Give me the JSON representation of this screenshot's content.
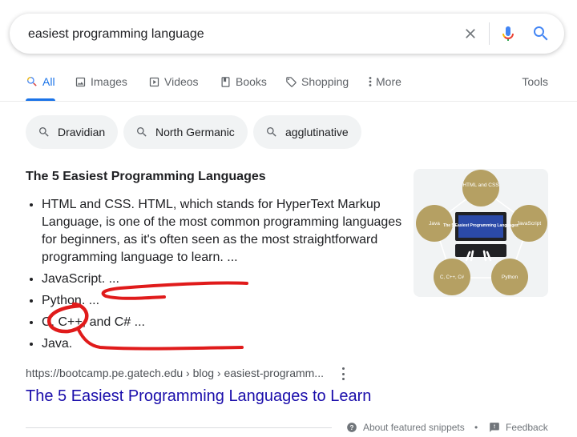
{
  "search": {
    "query": "easiest programming language"
  },
  "tabs": [
    {
      "label": "All",
      "icon": "search-icon",
      "active": true
    },
    {
      "label": "Images",
      "icon": "image-icon"
    },
    {
      "label": "Videos",
      "icon": "play-icon"
    },
    {
      "label": "Books",
      "icon": "book-icon"
    },
    {
      "label": "Shopping",
      "icon": "tag-icon"
    },
    {
      "label": "More",
      "icon": "vertical-dots-icon"
    }
  ],
  "tools_label": "Tools",
  "chips": [
    "Dravidian",
    "North Germanic",
    "agglutinative"
  ],
  "snippet": {
    "title": "The 5 Easiest Programming Languages",
    "items": [
      "HTML and CSS. HTML, which stands for HyperText Markup Language, is one of the most common programming languages for beginners, as it's often seen as the most straightforward programming language to learn. ...",
      "JavaScript. ...",
      "Python. ...",
      "C, C++, and C# ...",
      "Java."
    ],
    "thumbnail": {
      "center_title": "The 5 Easiest Programming Languages",
      "nodes": [
        "HTML and CSS",
        "JavaScript",
        "Python",
        "C, C++, C#",
        "Java"
      ]
    }
  },
  "result": {
    "url": "https://bootcamp.pe.gatech.edu › blog › easiest-programm...",
    "title": "The 5 Easiest Programming Languages to Learn"
  },
  "footer": {
    "about": "About featured snippets",
    "separator": "•",
    "feedback": "Feedback"
  },
  "colors": {
    "accent": "#1a73e8",
    "link": "#1a0dab",
    "chip_bg": "#f1f3f4",
    "annotation": "#e01b1b",
    "thumb_node": "#b5a063"
  }
}
